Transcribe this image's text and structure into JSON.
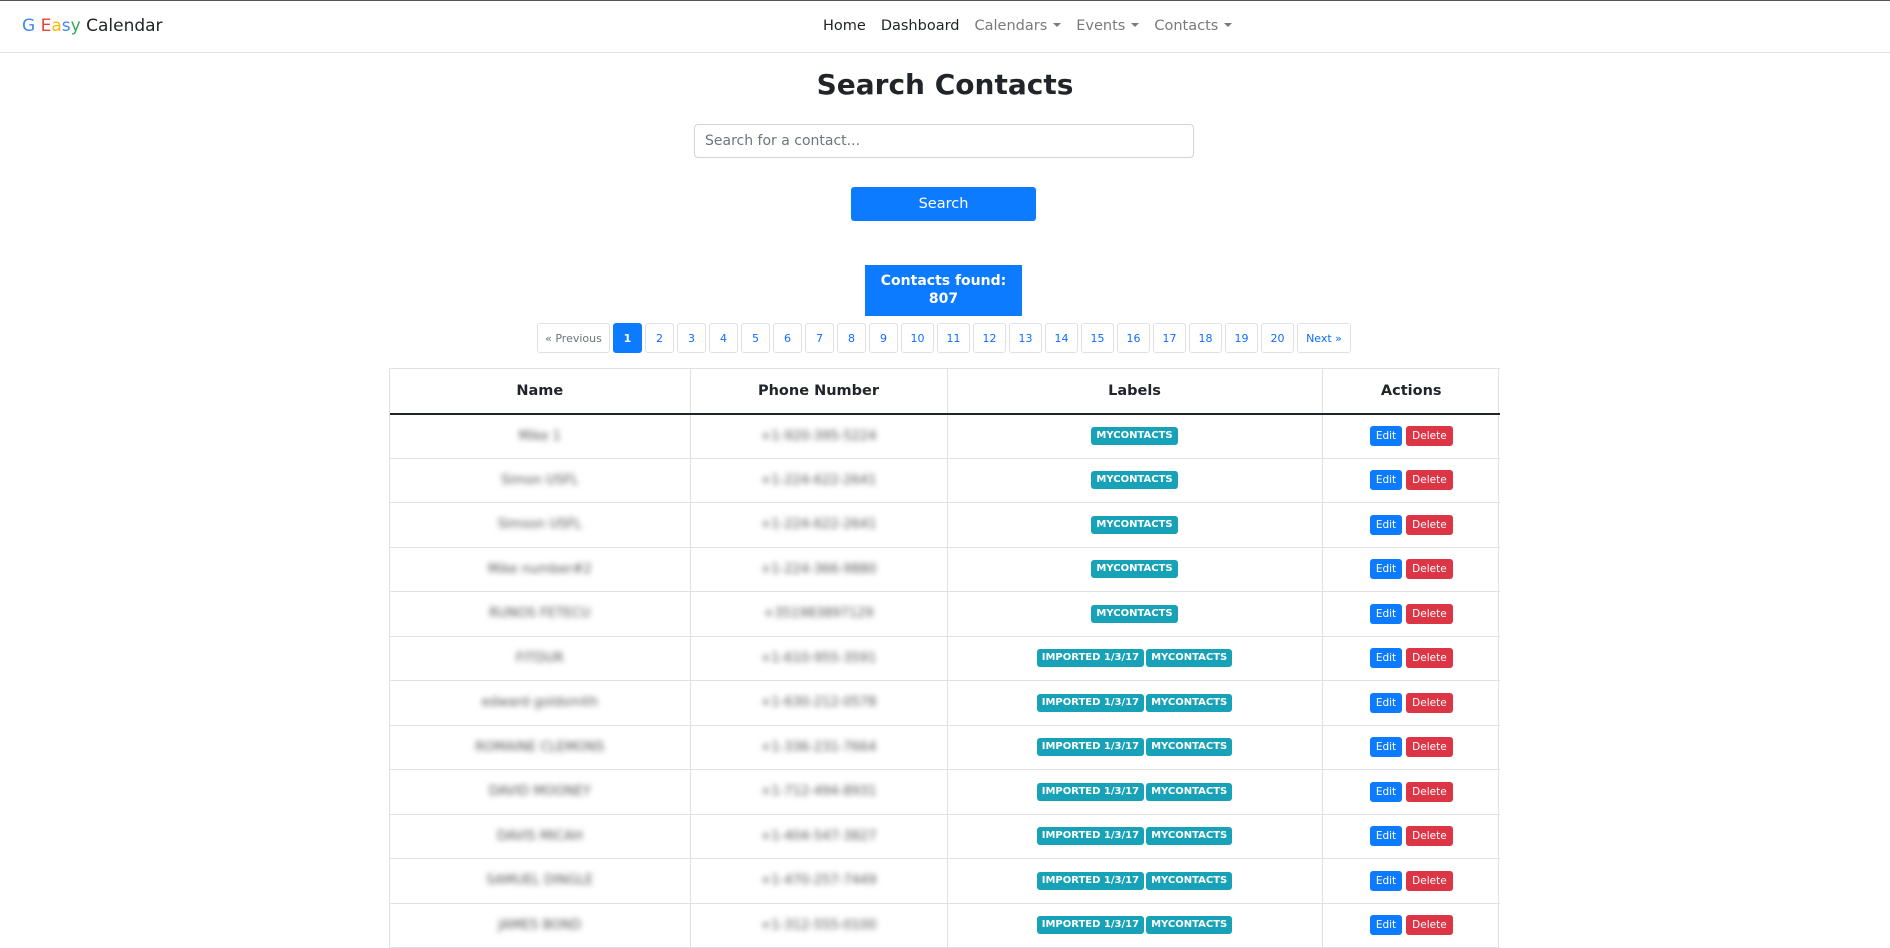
{
  "navbar": {
    "brand_letters": [
      "G",
      "E",
      "a",
      "s",
      "y"
    ],
    "brand_rest": "Calendar",
    "links": [
      {
        "label": "Home",
        "dropdown": false
      },
      {
        "label": "Dashboard",
        "dropdown": false
      },
      {
        "label": "Calendars",
        "dropdown": true
      },
      {
        "label": "Events",
        "dropdown": true
      },
      {
        "label": "Contacts",
        "dropdown": true
      }
    ]
  },
  "page_title": "Search Contacts",
  "search": {
    "placeholder": "Search for a contact...",
    "value": "",
    "button_label": "Search"
  },
  "results": {
    "found_label": "Contacts found:",
    "found_count": "807"
  },
  "pagination": {
    "prev_label": "« Previous",
    "next_label": "Next »",
    "pages": [
      "1",
      "2",
      "3",
      "4",
      "5",
      "6",
      "7",
      "8",
      "9",
      "10",
      "11",
      "12",
      "13",
      "14",
      "15",
      "16",
      "17",
      "18",
      "19",
      "20"
    ],
    "active_page": "1"
  },
  "table": {
    "headers": [
      "Name",
      "Phone Number",
      "Labels",
      "Actions"
    ],
    "edit_label": "Edit",
    "delete_label": "Delete",
    "rows": [
      {
        "name": "Mike 1",
        "phone": "+1-920-395-5224",
        "labels": [
          "MYCONTACTS"
        ]
      },
      {
        "name": "Simon USFL",
        "phone": "+1-224-622-2641",
        "labels": [
          "MYCONTACTS"
        ]
      },
      {
        "name": "Simson USFL",
        "phone": "+1-224-622-2641",
        "labels": [
          "MYCONTACTS"
        ]
      },
      {
        "name": "Mike number#2",
        "phone": "+1-224-366-9880",
        "labels": [
          "MYCONTACTS"
        ]
      },
      {
        "name": "RUNOS FETECU",
        "phone": "+351983897129",
        "labels": [
          "MYCONTACTS"
        ]
      },
      {
        "name": "FITDUR",
        "phone": "+1-610-955-3591",
        "labels": [
          "IMPORTED 1/3/17",
          "MYCONTACTS"
        ]
      },
      {
        "name": "edward goldsmith",
        "phone": "+1-630-212-0578",
        "labels": [
          "IMPORTED 1/3/17",
          "MYCONTACTS"
        ]
      },
      {
        "name": "ROMAINE CLEMONS",
        "phone": "+1-336-231-7664",
        "labels": [
          "IMPORTED 1/3/17",
          "MYCONTACTS"
        ]
      },
      {
        "name": "DAVID MOONEY",
        "phone": "+1-712-494-8931",
        "labels": [
          "IMPORTED 1/3/17",
          "MYCONTACTS"
        ]
      },
      {
        "name": "DAVIS MICAH",
        "phone": "+1-404-547-3827",
        "labels": [
          "IMPORTED 1/3/17",
          "MYCONTACTS"
        ]
      },
      {
        "name": "SAMUEL DINGLE",
        "phone": "+1-470-257-7449",
        "labels": [
          "IMPORTED 1/3/17",
          "MYCONTACTS"
        ]
      },
      {
        "name": "JAMES BOND",
        "phone": "+1-312-555-0100",
        "labels": [
          "IMPORTED 1/3/17",
          "MYCONTACTS"
        ]
      }
    ]
  },
  "colors": {
    "primary": "#0d7bff",
    "danger": "#dc3545",
    "label_badge": "#17a2b8"
  }
}
